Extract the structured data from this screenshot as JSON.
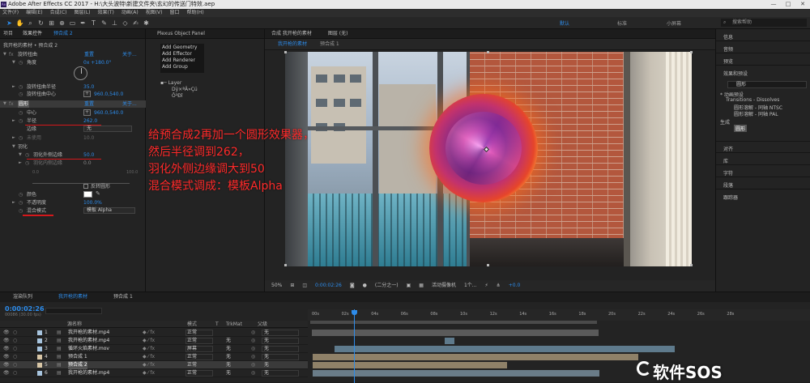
{
  "window": {
    "title": "Adobe After Effects CC 2017 - H:\\大头波特\\新建文件夹\\玄幻的传送门特效.aep",
    "controls": [
      "—",
      "□",
      "✕"
    ]
  },
  "menu": [
    "文件(F)",
    "编辑(E)",
    "合成(C)",
    "图层(L)",
    "效果(T)",
    "动画(A)",
    "视图(V)",
    "窗口",
    "帮助(H)"
  ],
  "workspaces": {
    "default": "默认",
    "standard": "标准",
    "small": "小屏幕"
  },
  "search_help": "搜索帮助",
  "effect_controls": {
    "tab_project": "项目",
    "tab_effect": "效果控件",
    "tab_layer": "预合成 2",
    "subtitle": "我开枪的素材 • 预合成 2",
    "twirl": {
      "name": "旋转扭曲",
      "reset": "重置",
      "about": "关于..."
    },
    "angle": {
      "label": "角度",
      "value": "0x +180.0°"
    },
    "twirl_radius": {
      "label": "旋转扭曲半径",
      "value": "35.0"
    },
    "twirl_center": {
      "label": "旋转扭曲中心",
      "value": "960.0,540.0"
    },
    "circle": {
      "name": "圆形",
      "reset": "重置",
      "about": "关于..."
    },
    "center": {
      "label": "中心",
      "value": "960.0,540.0"
    },
    "radius": {
      "label": "半径",
      "value": "262.0"
    },
    "edge": {
      "label": "边缘",
      "value": "无"
    },
    "unused": {
      "label": "未使用",
      "value": "10.0"
    },
    "feather": {
      "label": "羽化"
    },
    "feather_outer": {
      "label": "羽化外侧边缘",
      "value": "50.0"
    },
    "feather_inner": {
      "label": "羽化内侧边缘",
      "value": "0.0"
    },
    "slider_min": "0.0",
    "slider_max": "100.0",
    "invert": {
      "label": "反转圆形"
    },
    "color": {
      "label": "颜色",
      "value": "#ffffff"
    },
    "opacity": {
      "label": "不透明度",
      "value": "100.0%"
    },
    "blend": {
      "label": "混合模式",
      "value": "模板 Alpha"
    }
  },
  "plexus": {
    "title": "Plexus Object Panel",
    "menu": [
      "Add Geometry",
      "Add Effector",
      "Add Renderer",
      "Add Group"
    ],
    "layer": "Layer",
    "sub1": "Dÿ×ªÂ»Çü",
    "sub2": "Ô²Ðî"
  },
  "viewer": {
    "tab_comp": "合成 我开枪的素材",
    "tab_layer": "图层 (无)",
    "crumb_1": "我开枪的素材",
    "crumb_2": "预合成 1",
    "annotation": [
      "给预合成2再加一个圆形效果器，",
      "然后半径调到262，",
      "羽化外侧边缘调大到50",
      "混合模式调成：模板Alpha"
    ],
    "zoom": "50%",
    "timecode": "0:00:02:26",
    "resolution": "(二分之一)",
    "camera": "活动摄像机",
    "views": "1个...",
    "exposure": "+0.0"
  },
  "right_panels": {
    "info": "信息",
    "audio": "音频",
    "preview": "预览",
    "effects": "效果和预设",
    "search": "圆形",
    "folder": "* 动画预设",
    "transitions": "Transitions - Dissolves",
    "preset1": "圆形溶解 - 同轴 NTSC",
    "preset2": "圆形溶解 - 同轴 PAL",
    "generate": "生成",
    "circle_effect": "圆形",
    "align": "对齐",
    "libraries": "库",
    "character": "字符",
    "paragraph": "段落",
    "tracker": "跟踪器"
  },
  "timeline": {
    "tab_render": "渲染队列",
    "tab_comp1": "我开枪的素材",
    "tab_comp2": "预合成 1",
    "timecode": "0:00:02:26",
    "fps": "00086 (30.00 fps)",
    "col_source": "源名称",
    "col_mode": "模式",
    "col_trkmat": "TrkMat",
    "col_parent": "父级",
    "col_t": "T",
    "ruler": [
      "00s",
      "02s",
      "04s",
      "06s",
      "08s",
      "10s",
      "12s",
      "14s",
      "16s",
      "18s",
      "20s",
      "22s",
      "24s",
      "26s",
      "28s"
    ],
    "layers": [
      {
        "num": "1",
        "name": "我开枪的素材.mp4",
        "mode": "正常",
        "trkmat": "",
        "parent": "无",
        "color": "#a7c4de"
      },
      {
        "num": "2",
        "name": "我开枪的素材.mp4",
        "mode": "正常",
        "trkmat": "无",
        "parent": "无",
        "color": "#a7c4de"
      },
      {
        "num": "3",
        "name": "循环火焰素材.mov",
        "mode": "屏幕",
        "trkmat": "无",
        "parent": "无",
        "color": "#a7c4de"
      },
      {
        "num": "4",
        "name": "预合成 1",
        "mode": "正常",
        "trkmat": "无",
        "parent": "无",
        "color": "#d8c6a6"
      },
      {
        "num": "5",
        "name": "预合成 2",
        "mode": "正常",
        "trkmat": "无",
        "parent": "无",
        "color": "#d8c6a6"
      },
      {
        "num": "6",
        "name": "我开枪的素材.mp4",
        "mode": "正常",
        "trkmat": "无",
        "parent": "无",
        "color": "#a7c4de"
      }
    ]
  },
  "watermark": "软件SOS"
}
